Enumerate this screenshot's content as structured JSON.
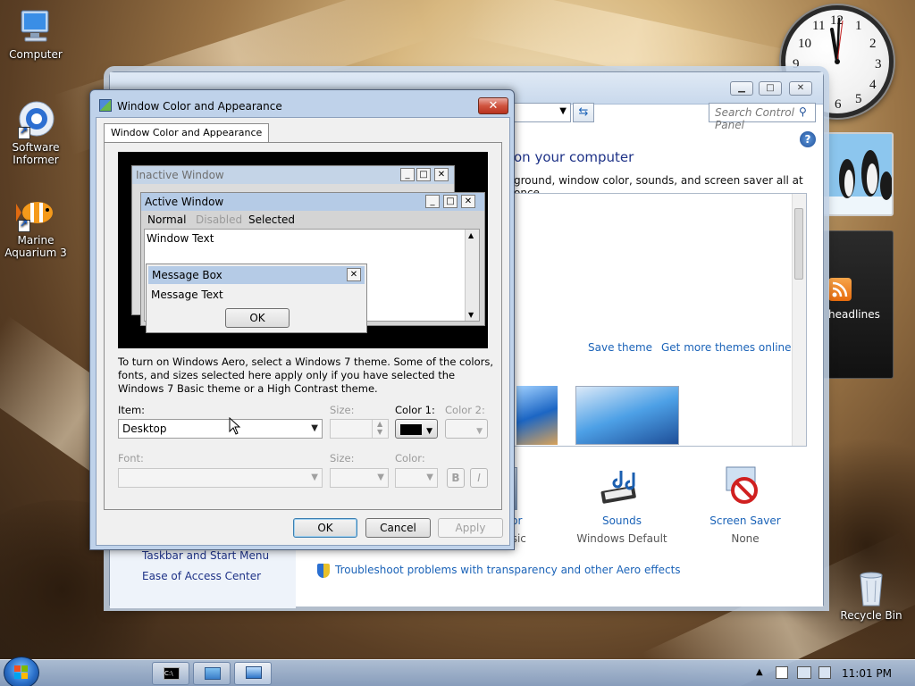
{
  "desktop": {
    "icons": [
      {
        "label": "Computer"
      },
      {
        "label": "Software Informer"
      },
      {
        "label": "Marine Aquarium 3"
      },
      {
        "label": "Recycle Bin"
      }
    ]
  },
  "gadgets": {
    "clock_numbers": [
      "12",
      "1",
      "2",
      "3",
      "4",
      "5",
      "6",
      "7",
      "8",
      "9",
      "10",
      "11"
    ],
    "feed_label": "headlines"
  },
  "control_panel": {
    "search_placeholder": "Search Control Panel",
    "heading": "on your computer",
    "subtext": "ground, window color, sounds, and screen saver all at once.",
    "save_theme": "Save theme",
    "get_more_themes": "Get more themes online",
    "color_label": "olor",
    "color_sub": "Basic",
    "sounds_label": "Sounds",
    "sounds_sub": "Windows Default",
    "screensaver_label": "Screen Saver",
    "screensaver_sub": "None",
    "left_links": [
      "Taskbar and Start Menu",
      "Ease of Access Center"
    ],
    "troubleshoot": "Troubleshoot problems with transparency and other Aero effects"
  },
  "dialog": {
    "title": "Window Color and Appearance",
    "close_glyph": "✕",
    "tab": "Window Color and Appearance",
    "preview": {
      "inactive_title": "Inactive Window",
      "active_title": "Active Window",
      "menu_normal": "Normal",
      "menu_disabled": "Disabled",
      "menu_selected": "Selected",
      "window_text": "Window Text",
      "msgbox_title": "Message Box",
      "msgbox_text": "Message Text",
      "msgbox_ok": "OK"
    },
    "description": "To turn on Windows Aero, select a Windows 7 theme.  Some of the colors, fonts, and sizes selected here apply only if you have selected the Windows 7 Basic theme or a High Contrast theme.",
    "item_label": "Item:",
    "item_value": "Desktop",
    "size_label": "Size:",
    "color1_label": "Color 1:",
    "color1_value": "#000000",
    "color2_label": "Color 2:",
    "font_label": "Font:",
    "font_size_label": "Size:",
    "font_color_label": "Color:",
    "bold_label": "B",
    "italic_label": "I",
    "ok": "OK",
    "cancel": "Cancel",
    "apply": "Apply"
  },
  "taskbar": {
    "time": "11:01 PM"
  }
}
